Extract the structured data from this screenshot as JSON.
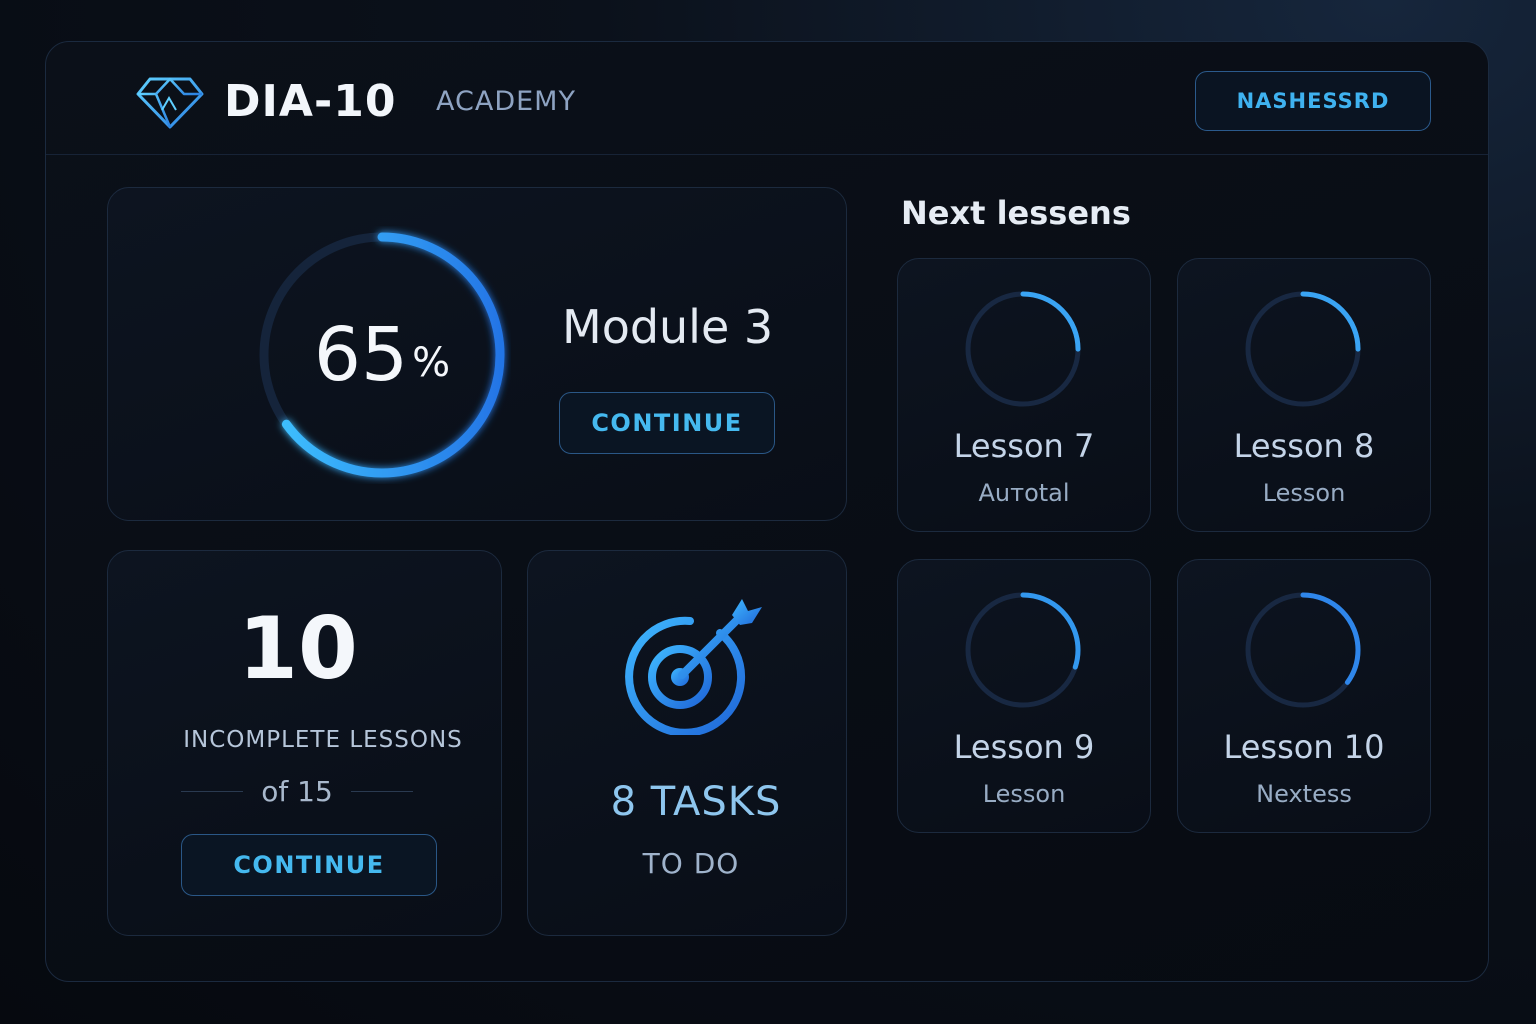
{
  "brand": {
    "name": "DIA-10",
    "subtitle": "ACADEMY",
    "logo_icon": "diamond-logo-icon"
  },
  "header": {
    "user_button_label": "NASHESSRD"
  },
  "colors": {
    "accent": "#3fb2f0",
    "accent_blue": "#2a7fe0",
    "background": "#06090f",
    "ring_track": "#1a2b45"
  },
  "progress": {
    "percent_value": "65",
    "percent_unit": "%",
    "fraction": 0.65,
    "module_title": "Module 3",
    "continue_label": "CONTINUE"
  },
  "incomplete": {
    "count": "10",
    "label": "INCOMPLETE LESSONS",
    "of_text": "of 15",
    "continue_label": "CONTINUE"
  },
  "tasks": {
    "icon": "target-icon",
    "count_label": "8 TASKS",
    "sub_label": "TO DO"
  },
  "next_lessons": {
    "title": "Next lessens",
    "items": [
      {
        "name": "Lesson 7",
        "subtitle": "Auтotal",
        "progress": 0.25
      },
      {
        "name": "Lesson 8",
        "subtitle": "Lesson",
        "progress": 0.25
      },
      {
        "name": "Lesson 9",
        "subtitle": "Lesson",
        "progress": 0.3
      },
      {
        "name": "Lesson 10",
        "subtitle": "Nextess",
        "progress": 0.35
      }
    ]
  }
}
